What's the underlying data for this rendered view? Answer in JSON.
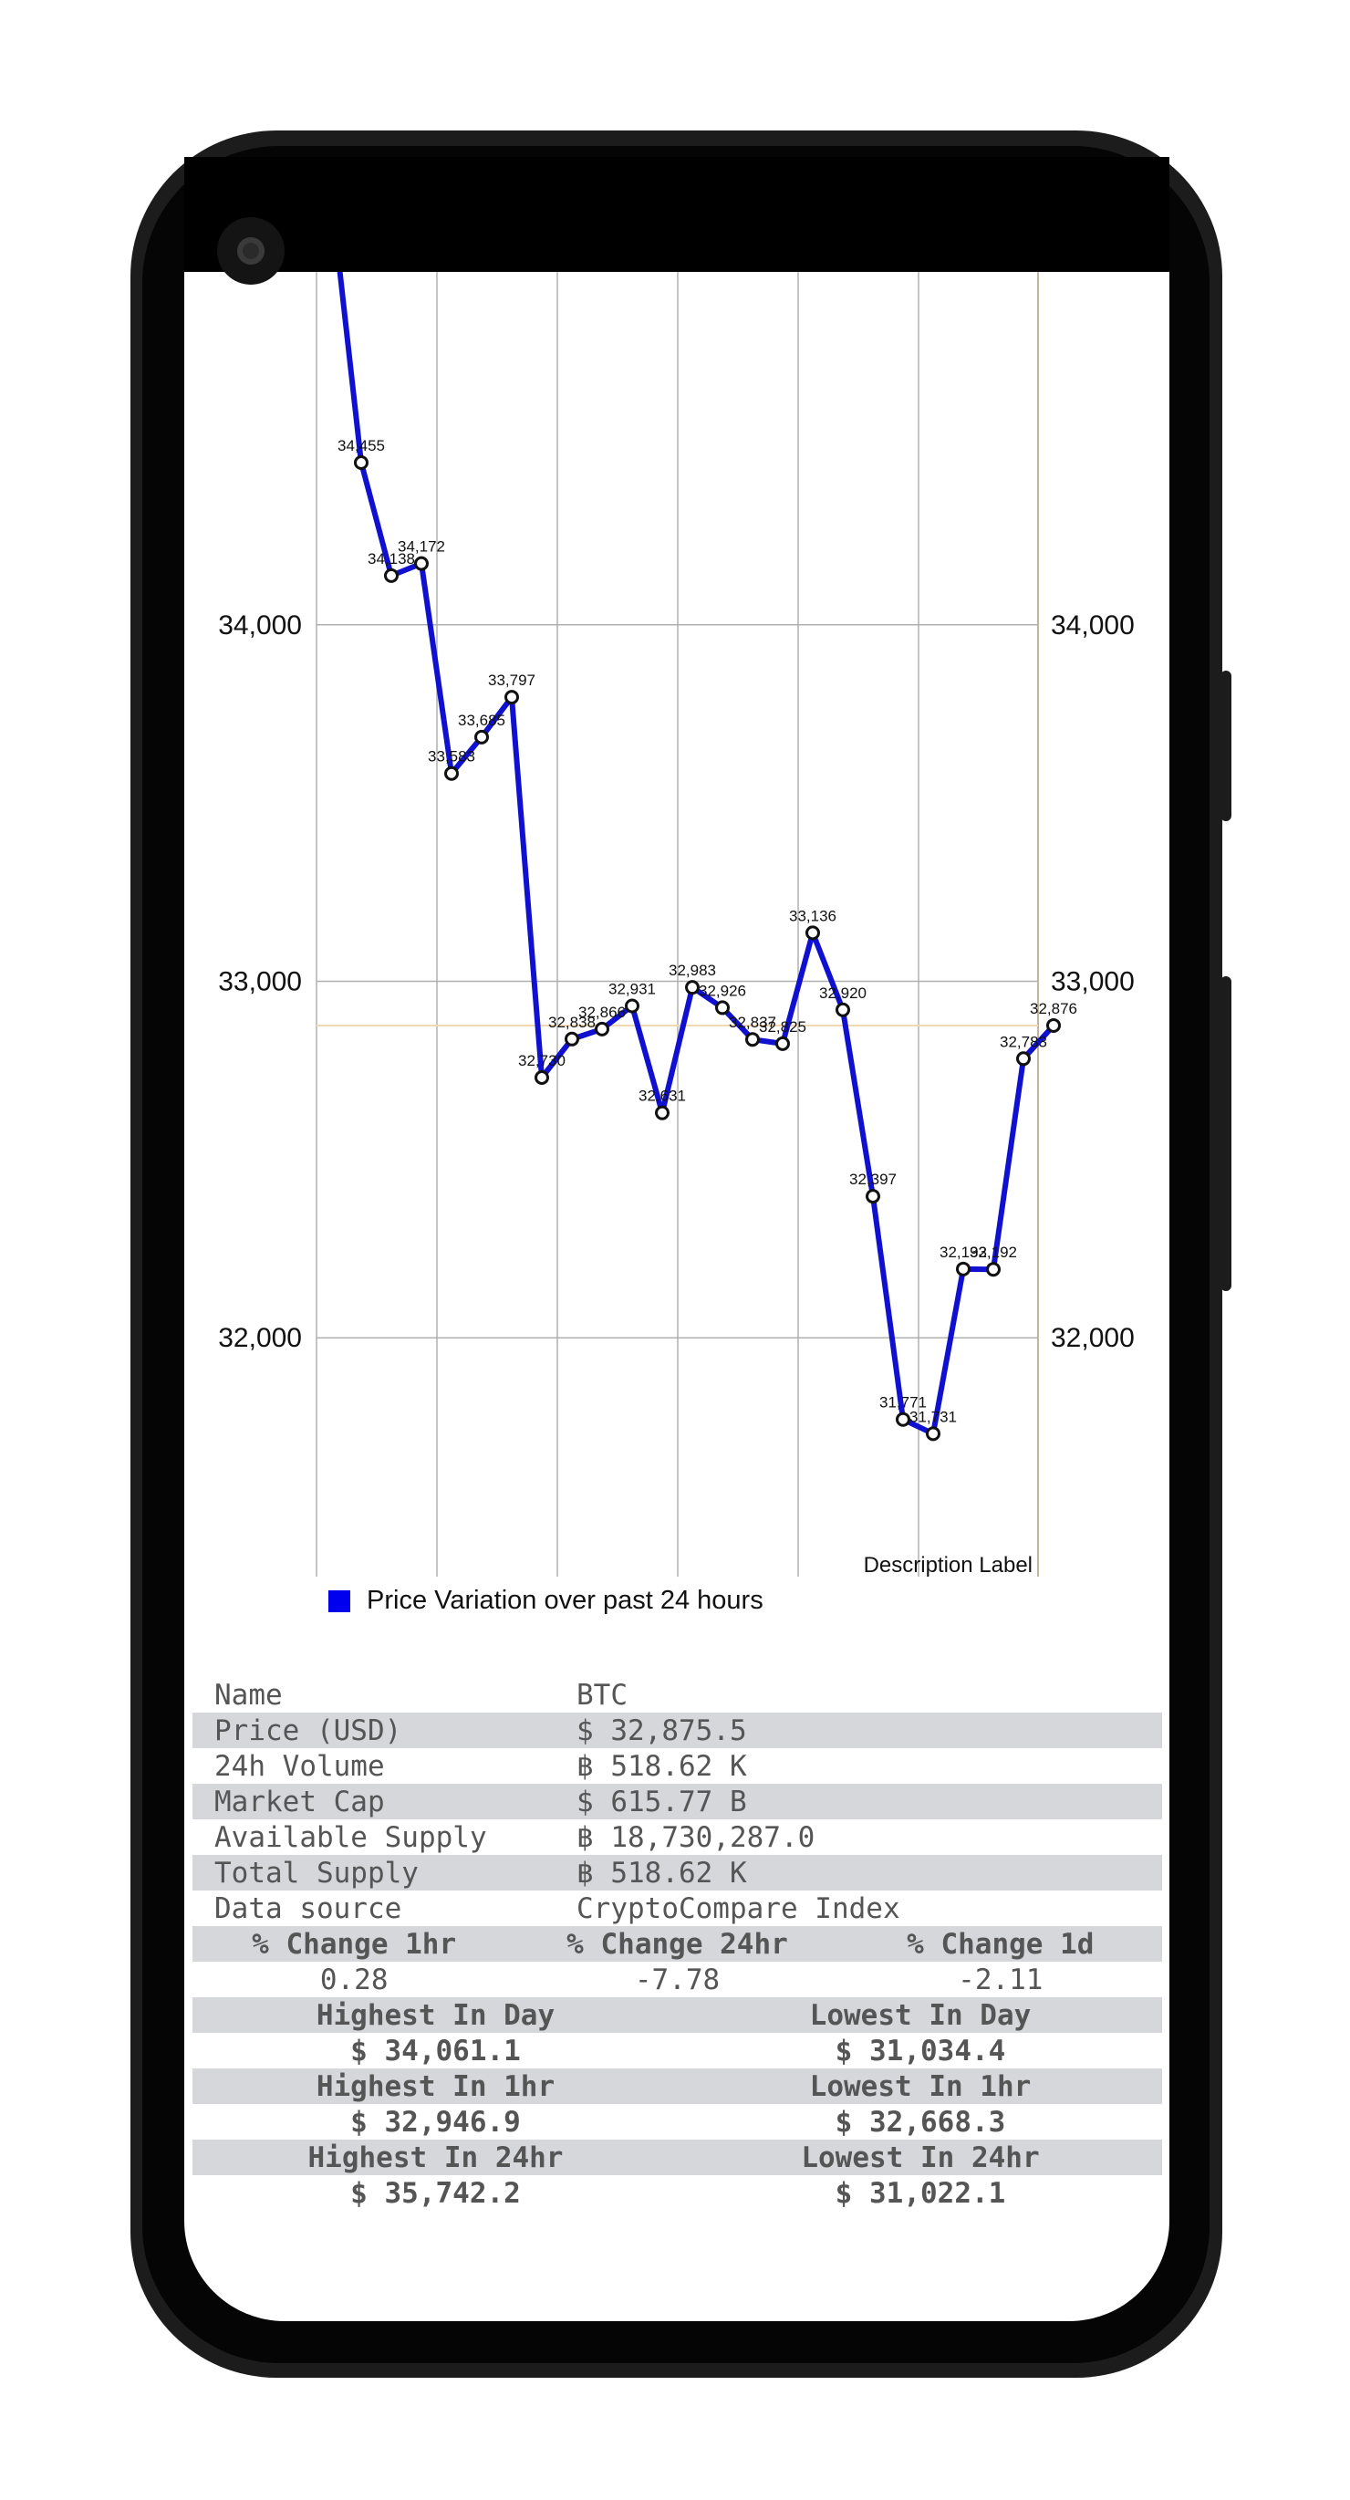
{
  "chart_data": {
    "type": "line",
    "series": [
      {
        "name": "Price Variation over past 24 hours",
        "values": [
          35210,
          34455,
          34138,
          34172,
          33583,
          33685,
          33797,
          32730,
          32838,
          32866,
          32931,
          32631,
          32983,
          32926,
          32837,
          32825,
          33136,
          32920,
          32397,
          31771,
          31731,
          32193,
          32192,
          32783,
          32876
        ]
      }
    ],
    "point_labels": [
      "",
      "34,455",
      "34,138",
      "34,172",
      "33,583",
      "33,685",
      "33,797",
      "32,730",
      "32,838",
      "32,866",
      "32,931",
      "32,631",
      "32,983",
      "32,926",
      "32,837",
      "32,825",
      "33,136",
      "32,920",
      "32,397",
      "31,771",
      "31,731",
      "32,193",
      "32,192",
      "32,783",
      "32,876"
    ],
    "y_ticks": [
      "32,000",
      "33,000",
      "34,000"
    ],
    "y_tick_values": [
      32000,
      33000,
      34000
    ],
    "ylim": [
      31330,
      34990
    ],
    "limit_line": 32876,
    "description": "Description Label",
    "legend_placement": "bottom-left",
    "grid": true,
    "colors": {
      "line": "#1010d0",
      "grid": "#b0b0b0",
      "limit": "#f0d8b0",
      "right_axis": "#c8b49c"
    }
  },
  "legend": {
    "label": "Price Variation over past 24 hours",
    "color": "#0000ee"
  },
  "description_label": "Description Label",
  "info": {
    "name": {
      "label": "Name",
      "value": "BTC"
    },
    "price": {
      "label": "Price (USD)",
      "value": "$ 32,875.5"
    },
    "volume": {
      "label": "24h Volume",
      "value": "฿ 518.62 K"
    },
    "market_cap": {
      "label": "Market Cap",
      "value": "$ 615.77 B"
    },
    "available_supply": {
      "label": "Available Supply",
      "value": "฿ 18,730,287.0"
    },
    "total_supply": {
      "label": "Total Supply",
      "value": "฿ 518.62 K"
    },
    "data_source": {
      "label": "Data source",
      "value": "CryptoCompare Index"
    },
    "change_headers": [
      "% Change 1hr",
      "% Change 24hr",
      "% Change 1d"
    ],
    "change_values": [
      "0.28",
      "-7.78",
      "-2.11"
    ],
    "day": {
      "high_label": "Highest In Day",
      "high_value": "$ 34,061.1",
      "low_label": "Lowest In Day",
      "low_value": "$ 31,034.4"
    },
    "hour": {
      "high_label": "Highest In 1hr",
      "high_value": "$ 32,946.9",
      "low_label": "Lowest In 1hr",
      "low_value": "$ 32,668.3"
    },
    "day24": {
      "high_label": "Highest In 24hr",
      "high_value": "$ 35,742.2",
      "low_label": "Lowest In 24hr",
      "low_value": "$ 31,022.1"
    }
  }
}
